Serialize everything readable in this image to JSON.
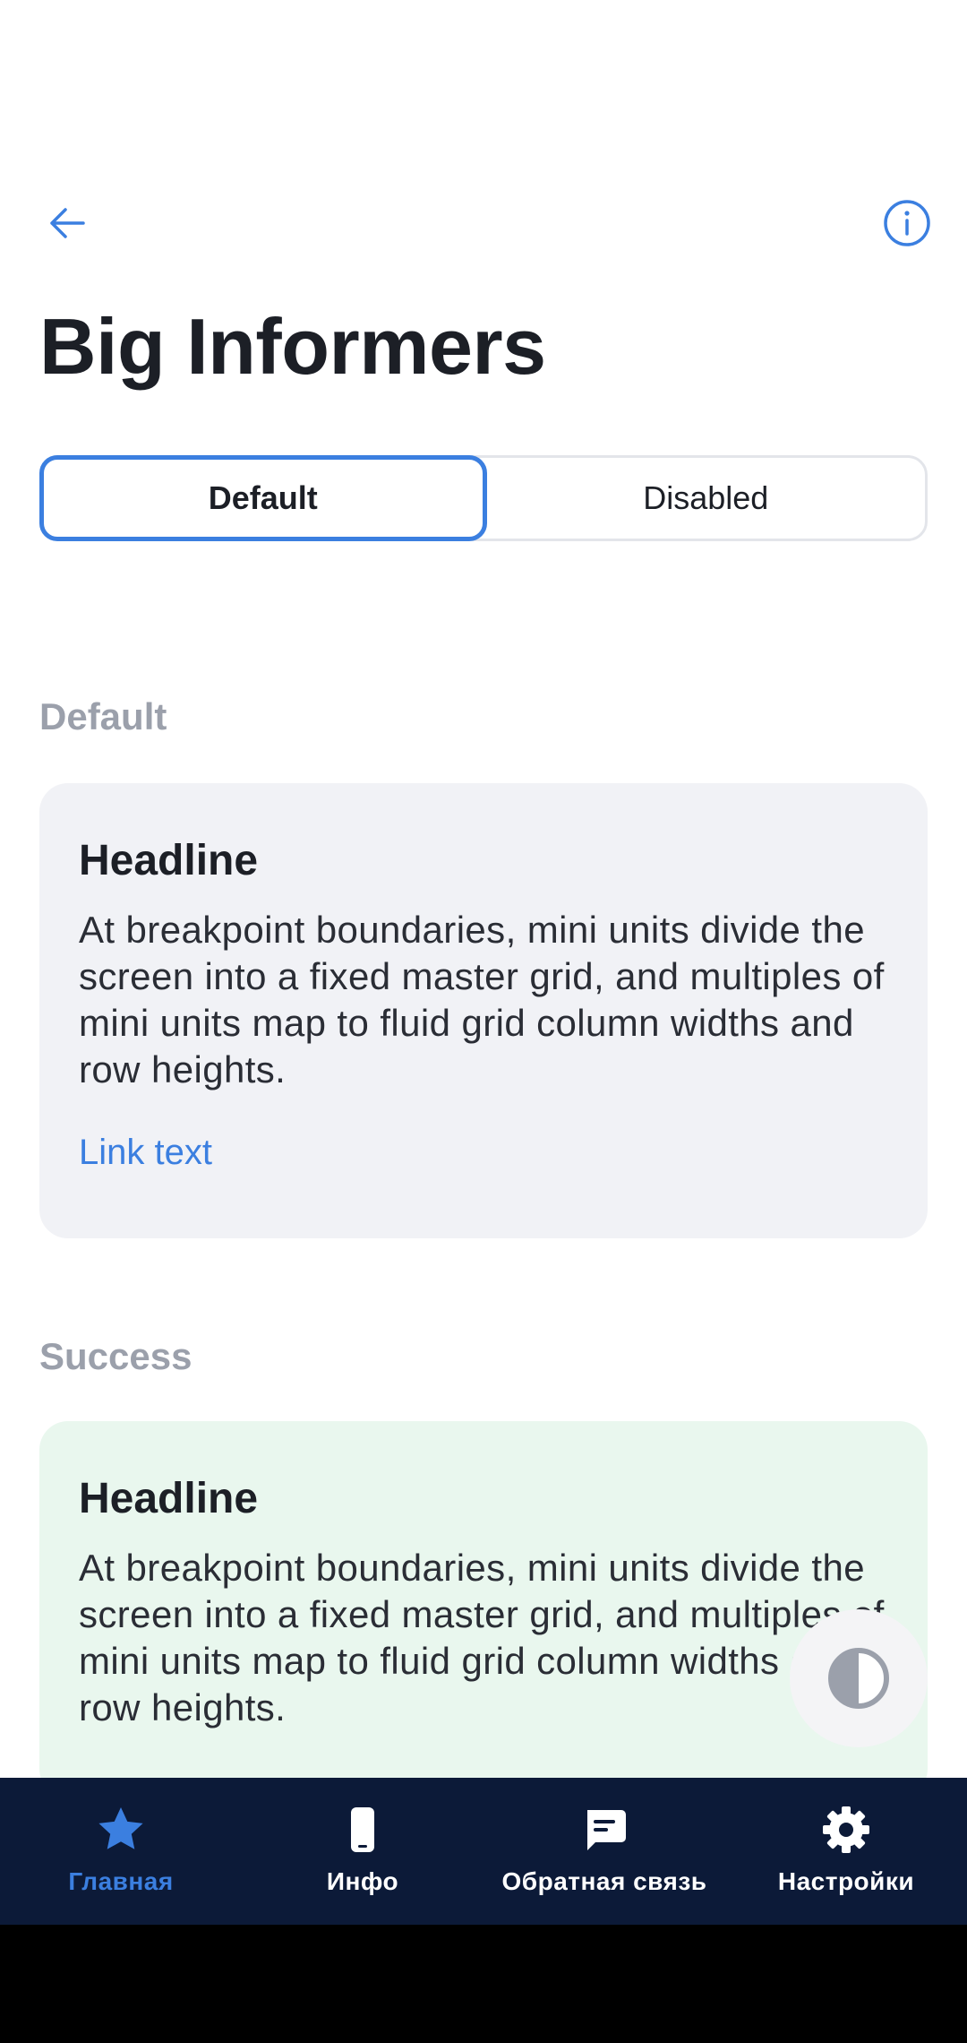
{
  "header": {
    "back_icon": "arrow-left-icon",
    "info_icon": "info-circle-icon",
    "title": "Big Informers"
  },
  "segments": [
    {
      "label": "Default",
      "selected": true
    },
    {
      "label": "Disabled",
      "selected": false
    }
  ],
  "sections": [
    {
      "label": "Default",
      "card": {
        "headline": "Headline",
        "body": "At breakpoint boundaries, mini units divide the screen into a fixed master grid, and multiples of mini units map to fluid grid column widths and row heights.",
        "link": "Link text"
      }
    },
    {
      "label": "Success",
      "card": {
        "headline": "Headline",
        "body": "At breakpoint boundaries, mini units divide the screen into a fixed master grid, and multiples of mini units map to fluid grid column widths and row heights."
      }
    }
  ],
  "fab": {
    "icon": "theme-contrast-icon"
  },
  "bottom_nav": [
    {
      "label": "Главная",
      "icon": "star-icon",
      "active": true
    },
    {
      "label": "Инфо",
      "icon": "phone-icon",
      "active": false
    },
    {
      "label": "Обратная связь",
      "icon": "chat-icon",
      "active": false
    },
    {
      "label": "Настройки",
      "icon": "gear-icon",
      "active": false
    }
  ],
  "colors": {
    "accent": "#3b7fe0",
    "nav_background": "#0c1a38",
    "default_card": "#f1f2f6",
    "success_card": "#e9f7ee",
    "section_label": "#9ba0ab"
  }
}
